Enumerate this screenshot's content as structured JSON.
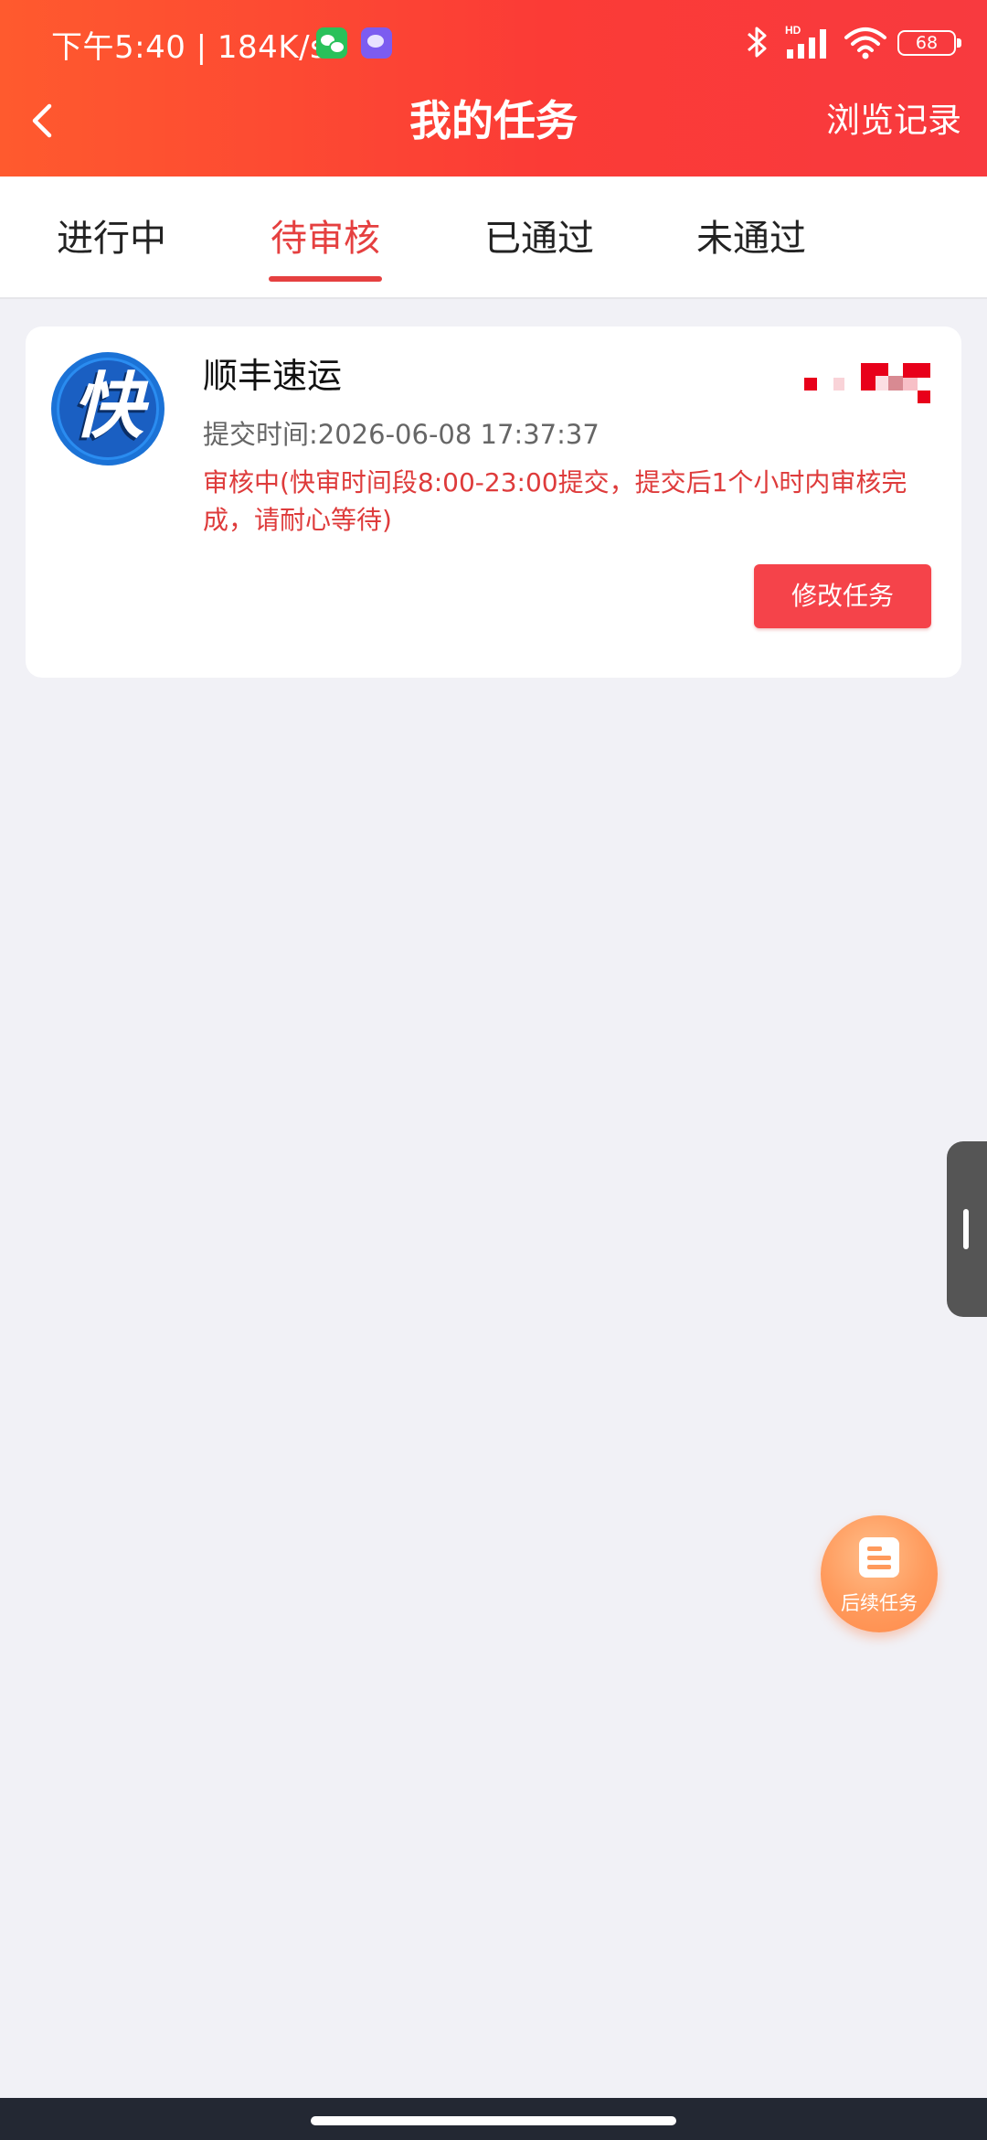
{
  "status_bar": {
    "time": "下午5:40 | 184K/s",
    "battery": "68",
    "icons": [
      "wechat-icon",
      "soul-app-icon",
      "bluetooth-icon",
      "hd-signal-icon",
      "wifi-icon",
      "battery-icon"
    ]
  },
  "nav": {
    "back_icon": "chevron-left-icon",
    "title": "我的任务",
    "right_label": "浏览记录"
  },
  "tabs": [
    {
      "label": "进行中",
      "active": false
    },
    {
      "label": "待审核",
      "active": true
    },
    {
      "label": "已通过",
      "active": false
    },
    {
      "label": "未通过",
      "active": false
    }
  ],
  "task_card": {
    "logo_text": "快",
    "title": "顺丰速运",
    "submit_time": "提交时间:2026-06-08 17:37:37",
    "status": "审核中(快审时间段8:00-23:00提交，提交后1个小时内审核完成，请耐心等待)",
    "button_label": "修改任务"
  },
  "float_button": {
    "icon": "document-list-icon",
    "label": "后续任务"
  },
  "colors": {
    "header_start": "#ff5a2e",
    "header_end": "#f83a3f",
    "accent_red": "#e54040",
    "button_red": "#f5434a",
    "page_bg": "#f1f1f6",
    "float_orange": "#ff9a5c"
  }
}
